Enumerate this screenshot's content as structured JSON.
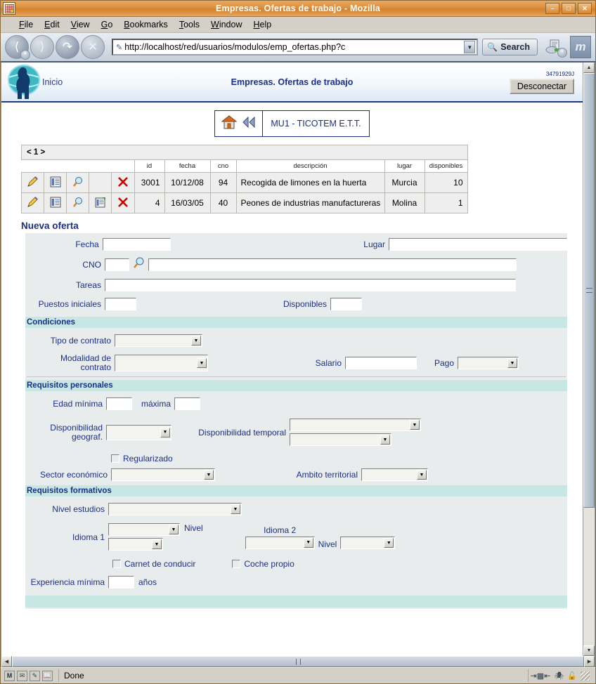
{
  "window": {
    "title": "Empresas. Ofertas de trabajo - Mozilla",
    "app_icon": "mozilla-window-icon",
    "minimize_label": "–",
    "maximize_label": "□",
    "close_label": "✕"
  },
  "menubar": {
    "items": [
      {
        "label": "File",
        "accel": "F"
      },
      {
        "label": "Edit",
        "accel": "E"
      },
      {
        "label": "View",
        "accel": "V"
      },
      {
        "label": "Go",
        "accel": "G"
      },
      {
        "label": "Bookmarks",
        "accel": "B"
      },
      {
        "label": "Tools",
        "accel": "T"
      },
      {
        "label": "Window",
        "accel": "W"
      },
      {
        "label": "Help",
        "accel": "H"
      }
    ]
  },
  "toolbar": {
    "back_icon": "back-arrow-icon",
    "forward_icon": "forward-arrow-icon",
    "reload_icon": "reload-icon",
    "stop_icon": "stop-icon",
    "url_value": "http://localhost/red/usuarios/modulos/emp_ofertas.php?c",
    "url_placeholder": "",
    "url_edit_icon": "pencil-icon",
    "url_dropdown_icon": "chevron-down-icon",
    "search_label": "Search",
    "search_icon": "search-icon",
    "print_icon": "print-icon",
    "logo_letter": "m"
  },
  "page_header": {
    "logo_icon": "person-globe-logo",
    "home_link": "Inicio",
    "title": "Empresas. Ofertas de trabajo",
    "user_id": "34791929J",
    "logout_label": "Desconectar"
  },
  "breadcrumb": {
    "home_icon": "home-icon",
    "back_icon": "rewind-icon",
    "label": "MU1 - TICOTEM E.T.T."
  },
  "offers_table": {
    "pager": "< 1 >",
    "columns": [
      "",
      "",
      "",
      "",
      "",
      "id",
      "fecha",
      "cno",
      "descripción",
      "lugar",
      "disponibles"
    ],
    "rows": [
      {
        "edit_icon": "pencil-edit-icon",
        "list_icon": "list-icon",
        "view_icon": "magnifier-icon",
        "extra_icon": "",
        "delete_icon": "delete-x-icon",
        "id": "3001",
        "fecha": "10/12/08",
        "cno": "94",
        "descripcion": "Recogida de limones en la huerta",
        "lugar": "Murcia",
        "disponibles": "10"
      },
      {
        "edit_icon": "pencil-edit-icon",
        "list_icon": "list-icon",
        "view_icon": "magnifier-icon",
        "extra_icon": "new-doc-icon",
        "delete_icon": "delete-x-icon",
        "id": "4",
        "fecha": "16/03/05",
        "cno": "40",
        "descripcion": "Peones de industrias manufactureras",
        "lugar": "Molina",
        "disponibles": "1"
      }
    ]
  },
  "form": {
    "title": "Nueva oferta",
    "general": {
      "fecha_label": "Fecha",
      "fecha_value": "",
      "lugar_label": "Lugar",
      "lugar_value": "",
      "cno_label": "CNO",
      "cno_value": "",
      "cno_lookup_icon": "magnifier-icon",
      "cno_desc_value": "",
      "tareas_label": "Tareas",
      "tareas_value": "",
      "puestos_label": "Puestos iniciales",
      "puestos_value": "",
      "disponibles_label": "Disponibles",
      "disponibles_value": ""
    },
    "condiciones": {
      "section_label": "Condiciones",
      "tipo_contrato_label": "Tipo de contrato",
      "tipo_contrato_value": "",
      "modalidad_label": "Modalidad de contrato",
      "modalidad_value": "",
      "salario_label": "Salario",
      "salario_value": "",
      "pago_label": "Pago",
      "pago_value": ""
    },
    "requisitos_personales": {
      "section_label": "Requisitos personales",
      "edad_min_label": "Edad mínima",
      "edad_min_value": "",
      "edad_max_label": "máxima",
      "edad_max_value": "",
      "disp_geo_label": "Disponibilidad geograf.",
      "disp_geo_value": "",
      "disp_temp_label": "Disponibilidad temporal",
      "disp_temp_value_1": "",
      "disp_temp_value_2": "",
      "regularizado_label": "Regularizado",
      "regularizado_checked": false,
      "sector_label": "Sector económico",
      "sector_value": "",
      "ambito_label": "Ambito territorial",
      "ambito_value": ""
    },
    "requisitos_formativos": {
      "section_label": "Requisitos formativos",
      "nivel_estudios_label": "Nivel estudios",
      "nivel_estudios_value": "",
      "idioma1_label": "Idioma 1",
      "idioma1_value": "",
      "idioma1_nivel_label": "Nivel",
      "idioma1_nivel_value": "",
      "idioma2_label": "Idioma 2",
      "idioma2_value": "",
      "idioma2_nivel_label": "Nivel",
      "idioma2_nivel_value": "",
      "carnet_label": "Carnet de conducir",
      "carnet_checked": false,
      "coche_label": "Coche propio",
      "coche_checked": false,
      "experiencia_label": "Experiencia mínima",
      "experiencia_value": "",
      "experiencia_unit": "años"
    }
  },
  "statusbar": {
    "status_text": "Done",
    "icons": [
      "browser-icon",
      "mail-icon",
      "compose-icon",
      "addressbook-icon"
    ],
    "right_icons": [
      "proxy-icon",
      "shield-icon",
      "lock-icon"
    ]
  },
  "colors": {
    "title_bar": "#dd8f3c",
    "accent_blue": "#1b2f86",
    "section_teal": "#c6e7e4",
    "form_bg": "#e8eced",
    "table_row": "#eeeeee",
    "delete_red": "#cc0000"
  }
}
